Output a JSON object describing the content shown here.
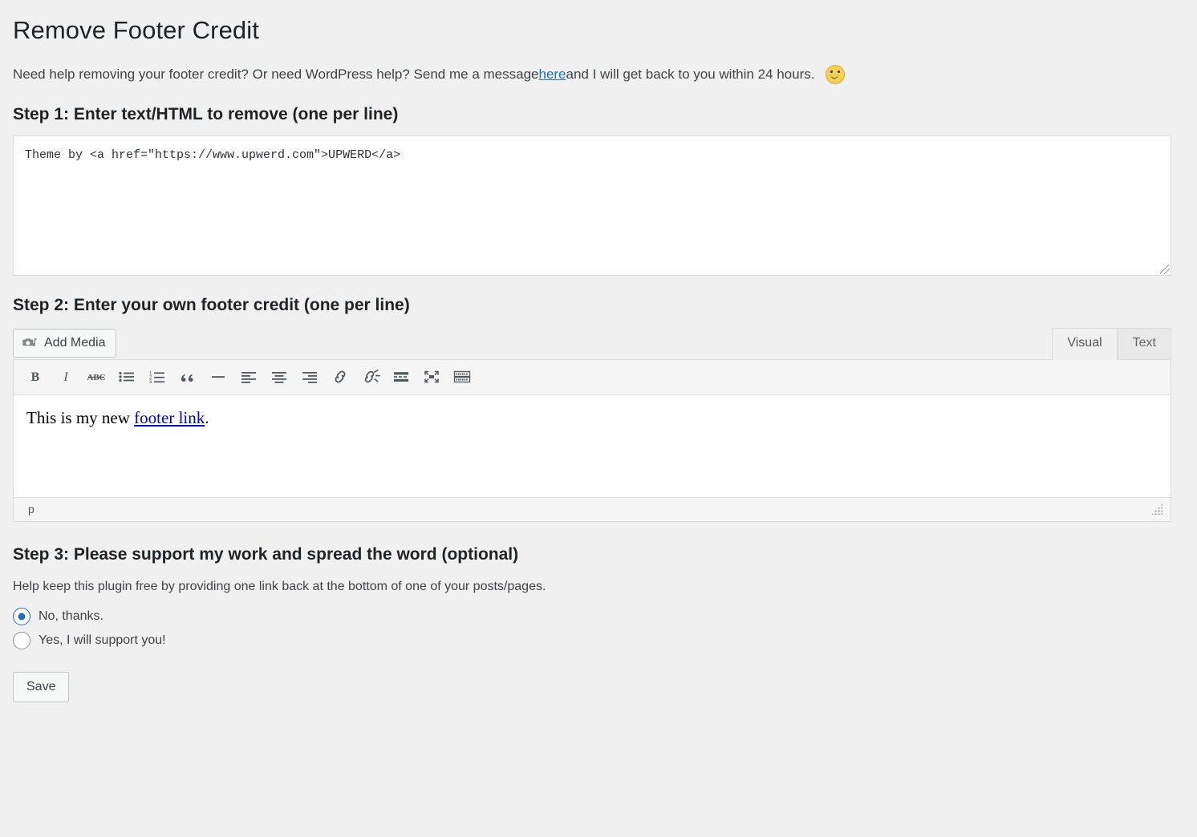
{
  "page": {
    "title": "Remove Footer Credit",
    "background_color": "#f0f0f1"
  },
  "intro": {
    "text_before_link": "Need help removing your footer credit? Or need WordPress help? Send me a message ",
    "link_label": "here",
    "link_color": "#2271b1",
    "text_after_link": " and I will get back to you within 24 hours.",
    "emoji_name": "slightly-smiling-face"
  },
  "step1": {
    "heading": "Step 1: Enter text/HTML to remove (one per line)",
    "textarea_value": "Theme by <a href=\"https://www.upwerd.com\">UPWERD</a>",
    "textarea_placeholder": ""
  },
  "step2": {
    "heading": "Step 2: Enter your own footer credit (one per line)",
    "add_media_label": "Add Media",
    "add_media_icon": "media-camera-music-icon",
    "tabs": [
      {
        "label": "Visual",
        "active": true
      },
      {
        "label": "Text",
        "active": false
      }
    ],
    "toolbar": [
      {
        "name": "bold-icon",
        "title": "Bold"
      },
      {
        "name": "italic-icon",
        "title": "Italic"
      },
      {
        "name": "strikethrough-icon",
        "title": "Strikethrough"
      },
      {
        "name": "bulleted-list-icon",
        "title": "Bulleted list"
      },
      {
        "name": "numbered-list-icon",
        "title": "Numbered list"
      },
      {
        "name": "blockquote-icon",
        "title": "Blockquote"
      },
      {
        "name": "horizontal-rule-icon",
        "title": "Horizontal line"
      },
      {
        "name": "align-left-icon",
        "title": "Align left"
      },
      {
        "name": "align-center-icon",
        "title": "Align center"
      },
      {
        "name": "align-right-icon",
        "title": "Align right"
      },
      {
        "name": "insert-link-icon",
        "title": "Insert/edit link"
      },
      {
        "name": "remove-link-icon",
        "title": "Remove link"
      },
      {
        "name": "read-more-icon",
        "title": "Insert Read More tag"
      },
      {
        "name": "fullscreen-icon",
        "title": "Distraction-free writing mode"
      },
      {
        "name": "toolbar-toggle-icon",
        "title": "Toolbar Toggle"
      }
    ],
    "editor_text_before_link": "This is my new ",
    "editor_link_label": "footer link",
    "editor_link_color": "#0000cc",
    "editor_text_after_link": ".",
    "status_path": "p"
  },
  "step3": {
    "heading": "Step 3: Please support my work and spread the word (optional)",
    "help_text": "Help keep this plugin free by providing one link back at the bottom of one of your posts/pages.",
    "options": [
      {
        "label": "No, thanks.",
        "selected": true
      },
      {
        "label": "Yes, I will support you!",
        "selected": false
      }
    ],
    "selected_color": "#2271b1"
  },
  "footer": {
    "save_label": "Save"
  }
}
